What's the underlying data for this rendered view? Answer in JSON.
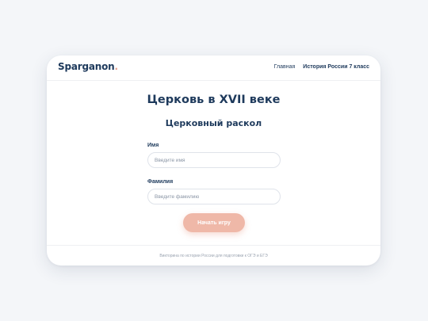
{
  "header": {
    "logo_text": "Sparganon",
    "logo_dot": ".",
    "nav": [
      {
        "label": "Главная"
      },
      {
        "label": "История России 7 класс"
      }
    ]
  },
  "main": {
    "title": "Церковь в XVII веке",
    "subtitle": "Церковный раскол",
    "form": {
      "first_name_label": "Имя",
      "first_name_placeholder": "Введите имя",
      "last_name_label": "Фамилия",
      "last_name_placeholder": "Введите фамилию",
      "submit_label": "Начать игру"
    }
  },
  "footer": {
    "text": "Викторина по истории России для подготовки к ОГЭ и ЕГЭ"
  },
  "colors": {
    "brand": "#1e3a5c",
    "accent": "#efb8a8",
    "background": "#f4f6f9"
  }
}
